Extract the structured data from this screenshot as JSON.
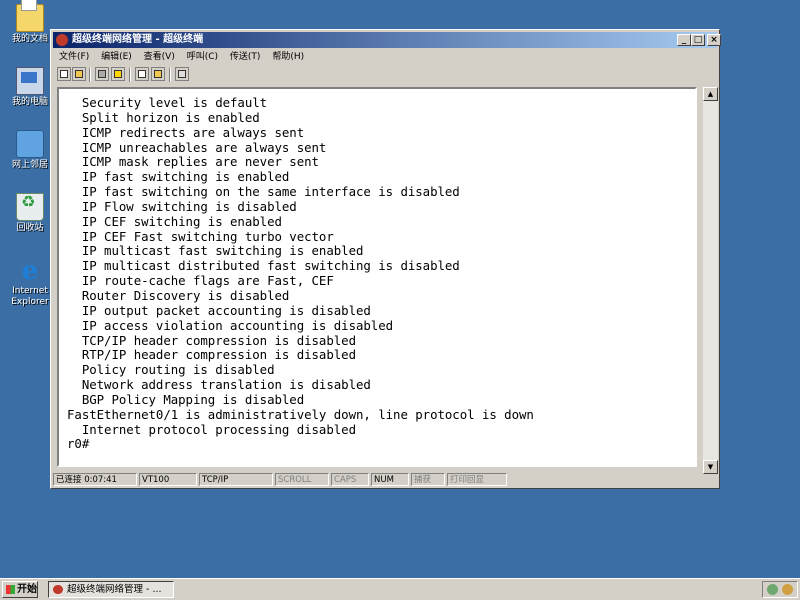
{
  "desktop": {
    "icons": [
      {
        "label": "我的文档",
        "icon": "my-documents-icon"
      },
      {
        "label": "我的电脑",
        "icon": "my-computer-icon"
      },
      {
        "label": "网上邻居",
        "icon": "network-neighborhood-icon"
      },
      {
        "label": "回收站",
        "icon": "recycle-bin-icon"
      },
      {
        "label": "Internet Explorer",
        "icon": "internet-explorer-icon"
      }
    ]
  },
  "window": {
    "title": "超级终端网络管理 - 超级终端",
    "buttons": {
      "minimize": "_",
      "maximize": "□",
      "close": "×"
    },
    "menu": [
      "文件(F)",
      "编辑(E)",
      "查看(V)",
      "呼叫(C)",
      "传送(T)",
      "帮助(H)"
    ],
    "toolbar_icons": [
      "new-icon",
      "open-icon",
      "disconnect-icon",
      "call-icon",
      "send-icon",
      "receive-icon",
      "properties-icon"
    ],
    "terminal_lines": [
      "  Security level is default",
      "  Split horizon is enabled",
      "  ICMP redirects are always sent",
      "  ICMP unreachables are always sent",
      "  ICMP mask replies are never sent",
      "  IP fast switching is enabled",
      "  IP fast switching on the same interface is disabled",
      "  IP Flow switching is disabled",
      "  IP CEF switching is enabled",
      "  IP CEF Fast switching turbo vector",
      "  IP multicast fast switching is enabled",
      "  IP multicast distributed fast switching is disabled",
      "  IP route-cache flags are Fast, CEF",
      "  Router Discovery is disabled",
      "  IP output packet accounting is disabled",
      "  IP access violation accounting is disabled",
      "  TCP/IP header compression is disabled",
      "  RTP/IP header compression is disabled",
      "  Policy routing is disabled",
      "  Network address translation is disabled",
      "  BGP Policy Mapping is disabled",
      "FastEthernet0/1 is administratively down, line protocol is down",
      "  Internet protocol processing disabled",
      "r0#"
    ],
    "status": {
      "connected": "已连接 0:07:41",
      "emulation": "VT100",
      "protocol": "TCP/IP",
      "scroll": "SCROLL",
      "caps": "CAPS",
      "num": "NUM",
      "capture": "捕获",
      "print_echo": "打印回显"
    }
  },
  "taskbar": {
    "start_label": "开始",
    "task_label": "超级终端网络管理 - ..."
  },
  "colors": {
    "desktop": "#3a6ea5",
    "titlebar_start": "#0a246a",
    "titlebar_end": "#a6caf0",
    "chrome": "#d4d0c8"
  }
}
